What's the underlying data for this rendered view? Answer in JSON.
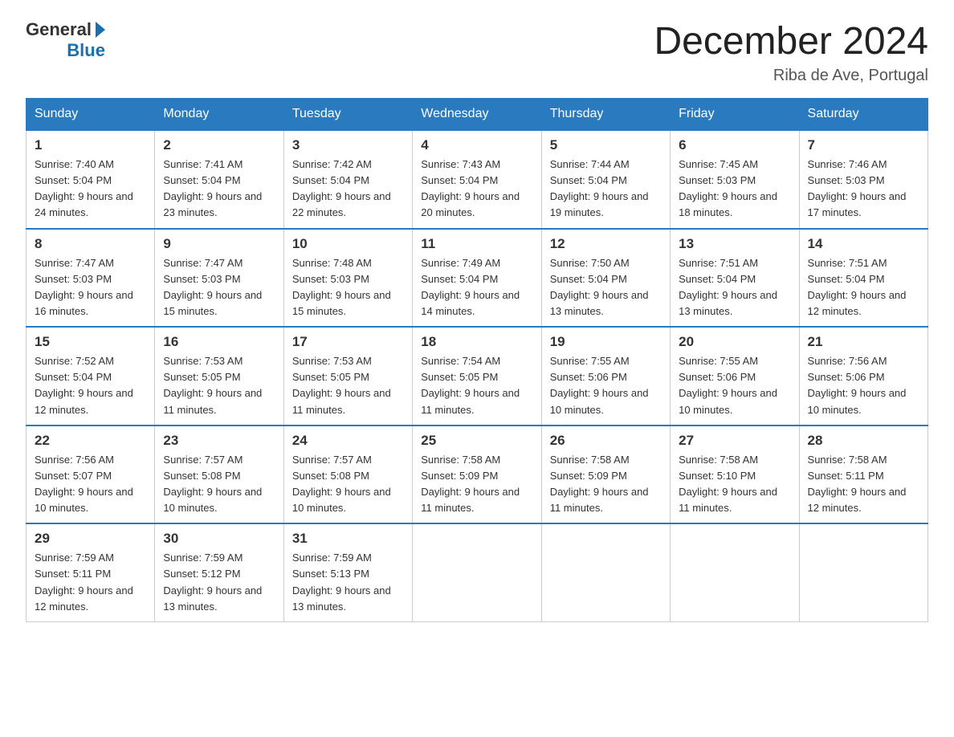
{
  "logo": {
    "general": "General",
    "blue": "Blue"
  },
  "title": "December 2024",
  "location": "Riba de Ave, Portugal",
  "days_of_week": [
    "Sunday",
    "Monday",
    "Tuesday",
    "Wednesday",
    "Thursday",
    "Friday",
    "Saturday"
  ],
  "weeks": [
    [
      {
        "day": "1",
        "sunrise": "7:40 AM",
        "sunset": "5:04 PM",
        "daylight": "9 hours and 24 minutes."
      },
      {
        "day": "2",
        "sunrise": "7:41 AM",
        "sunset": "5:04 PM",
        "daylight": "9 hours and 23 minutes."
      },
      {
        "day": "3",
        "sunrise": "7:42 AM",
        "sunset": "5:04 PM",
        "daylight": "9 hours and 22 minutes."
      },
      {
        "day": "4",
        "sunrise": "7:43 AM",
        "sunset": "5:04 PM",
        "daylight": "9 hours and 20 minutes."
      },
      {
        "day": "5",
        "sunrise": "7:44 AM",
        "sunset": "5:04 PM",
        "daylight": "9 hours and 19 minutes."
      },
      {
        "day": "6",
        "sunrise": "7:45 AM",
        "sunset": "5:03 PM",
        "daylight": "9 hours and 18 minutes."
      },
      {
        "day": "7",
        "sunrise": "7:46 AM",
        "sunset": "5:03 PM",
        "daylight": "9 hours and 17 minutes."
      }
    ],
    [
      {
        "day": "8",
        "sunrise": "7:47 AM",
        "sunset": "5:03 PM",
        "daylight": "9 hours and 16 minutes."
      },
      {
        "day": "9",
        "sunrise": "7:47 AM",
        "sunset": "5:03 PM",
        "daylight": "9 hours and 15 minutes."
      },
      {
        "day": "10",
        "sunrise": "7:48 AM",
        "sunset": "5:03 PM",
        "daylight": "9 hours and 15 minutes."
      },
      {
        "day": "11",
        "sunrise": "7:49 AM",
        "sunset": "5:04 PM",
        "daylight": "9 hours and 14 minutes."
      },
      {
        "day": "12",
        "sunrise": "7:50 AM",
        "sunset": "5:04 PM",
        "daylight": "9 hours and 13 minutes."
      },
      {
        "day": "13",
        "sunrise": "7:51 AM",
        "sunset": "5:04 PM",
        "daylight": "9 hours and 13 minutes."
      },
      {
        "day": "14",
        "sunrise": "7:51 AM",
        "sunset": "5:04 PM",
        "daylight": "9 hours and 12 minutes."
      }
    ],
    [
      {
        "day": "15",
        "sunrise": "7:52 AM",
        "sunset": "5:04 PM",
        "daylight": "9 hours and 12 minutes."
      },
      {
        "day": "16",
        "sunrise": "7:53 AM",
        "sunset": "5:05 PM",
        "daylight": "9 hours and 11 minutes."
      },
      {
        "day": "17",
        "sunrise": "7:53 AM",
        "sunset": "5:05 PM",
        "daylight": "9 hours and 11 minutes."
      },
      {
        "day": "18",
        "sunrise": "7:54 AM",
        "sunset": "5:05 PM",
        "daylight": "9 hours and 11 minutes."
      },
      {
        "day": "19",
        "sunrise": "7:55 AM",
        "sunset": "5:06 PM",
        "daylight": "9 hours and 10 minutes."
      },
      {
        "day": "20",
        "sunrise": "7:55 AM",
        "sunset": "5:06 PM",
        "daylight": "9 hours and 10 minutes."
      },
      {
        "day": "21",
        "sunrise": "7:56 AM",
        "sunset": "5:06 PM",
        "daylight": "9 hours and 10 minutes."
      }
    ],
    [
      {
        "day": "22",
        "sunrise": "7:56 AM",
        "sunset": "5:07 PM",
        "daylight": "9 hours and 10 minutes."
      },
      {
        "day": "23",
        "sunrise": "7:57 AM",
        "sunset": "5:08 PM",
        "daylight": "9 hours and 10 minutes."
      },
      {
        "day": "24",
        "sunrise": "7:57 AM",
        "sunset": "5:08 PM",
        "daylight": "9 hours and 10 minutes."
      },
      {
        "day": "25",
        "sunrise": "7:58 AM",
        "sunset": "5:09 PM",
        "daylight": "9 hours and 11 minutes."
      },
      {
        "day": "26",
        "sunrise": "7:58 AM",
        "sunset": "5:09 PM",
        "daylight": "9 hours and 11 minutes."
      },
      {
        "day": "27",
        "sunrise": "7:58 AM",
        "sunset": "5:10 PM",
        "daylight": "9 hours and 11 minutes."
      },
      {
        "day": "28",
        "sunrise": "7:58 AM",
        "sunset": "5:11 PM",
        "daylight": "9 hours and 12 minutes."
      }
    ],
    [
      {
        "day": "29",
        "sunrise": "7:59 AM",
        "sunset": "5:11 PM",
        "daylight": "9 hours and 12 minutes."
      },
      {
        "day": "30",
        "sunrise": "7:59 AM",
        "sunset": "5:12 PM",
        "daylight": "9 hours and 13 minutes."
      },
      {
        "day": "31",
        "sunrise": "7:59 AM",
        "sunset": "5:13 PM",
        "daylight": "9 hours and 13 minutes."
      },
      null,
      null,
      null,
      null
    ]
  ]
}
